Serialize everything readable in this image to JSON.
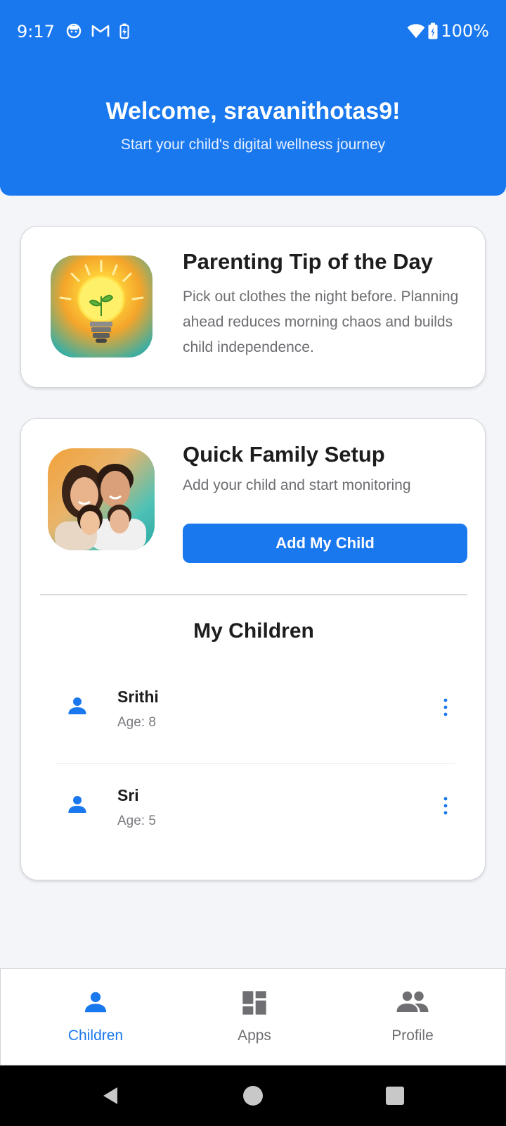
{
  "status_bar": {
    "time": "9:17",
    "battery_pct": "100%",
    "left_icons": [
      "face-icon",
      "gmail-icon",
      "battery-saver-icon"
    ],
    "right_icons": [
      "wifi-icon",
      "battery-icon"
    ]
  },
  "header": {
    "title": "Welcome, sravanithotas9!",
    "subtitle": "Start your child's digital wellness journey",
    "color": "#1a78ee"
  },
  "tip_card": {
    "image": "lightbulb-plant-image",
    "title": "Parenting Tip of the Day",
    "text": "Pick out clothes the night before. Planning ahead reduces morning chaos and builds child independence."
  },
  "setup_card": {
    "image": "family-photo-image",
    "title": "Quick Family Setup",
    "subtitle": "Add your child and start monitoring",
    "button_label": "Add My Child"
  },
  "children_section": {
    "title": "My Children",
    "children": [
      {
        "name": "Srithi",
        "age": "Age: 8"
      },
      {
        "name": "Sri",
        "age": "Age: 5"
      }
    ]
  },
  "bottom_nav": {
    "active_color": "#1a78ee",
    "inactive_color": "#6f6f73",
    "items": [
      {
        "label": "Children",
        "icon": "person-icon",
        "active": true
      },
      {
        "label": "Apps",
        "icon": "dashboard-icon",
        "active": false
      },
      {
        "label": "Profile",
        "icon": "people-icon",
        "active": false
      }
    ]
  }
}
